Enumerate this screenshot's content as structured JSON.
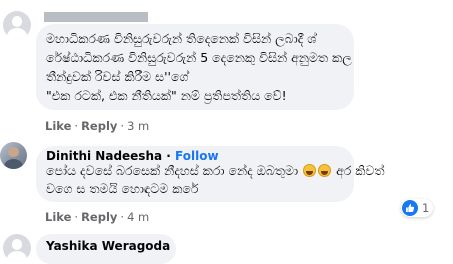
{
  "comments": [
    {
      "text_lines": [
        "මහාධිකරණ විනිසුරුවරුන් තිදෙනෙක් විසින් ලබාදී ශ්",
        "රේෂ්ඨාධිකරණ විනිසුරුවරුන් 5 දෙනෙකු විසින් අනුමත කල",
        "තීන්දුවක් රිවස් කිරීම ස''ගේ",
        "\"එක රටක්, එක නීතියක්\" නම් ප්‍රතිපත්තිය වේ!"
      ],
      "actions": {
        "like": "Like",
        "reply": "Reply",
        "separator": "·",
        "time": "3 m"
      }
    },
    {
      "author": "Dinithi Nadeesha",
      "follow_label": "Follow",
      "text_line_1_before": "පෝය දවසේ බරසෙක් නීදහස් කරා නේද ඔබතුමා",
      "text_line_1_after": "අර කිවත්",
      "text_line_2": "වගෙ ස තමයි හොඳටම කරේ",
      "emojis": [
        "grinning-face-emoji",
        "grinning-face-emoji"
      ],
      "actions": {
        "like": "Like",
        "reply": "Reply",
        "separator": "·",
        "time": "4 m"
      },
      "reaction_count": "1"
    },
    {
      "author": "Yashika Weragoda"
    }
  ],
  "colors": {
    "bubble": "#f0f2f5",
    "meta_text": "#65676b",
    "link_blue": "#1877f2",
    "redaction": "#b9bdc4"
  }
}
